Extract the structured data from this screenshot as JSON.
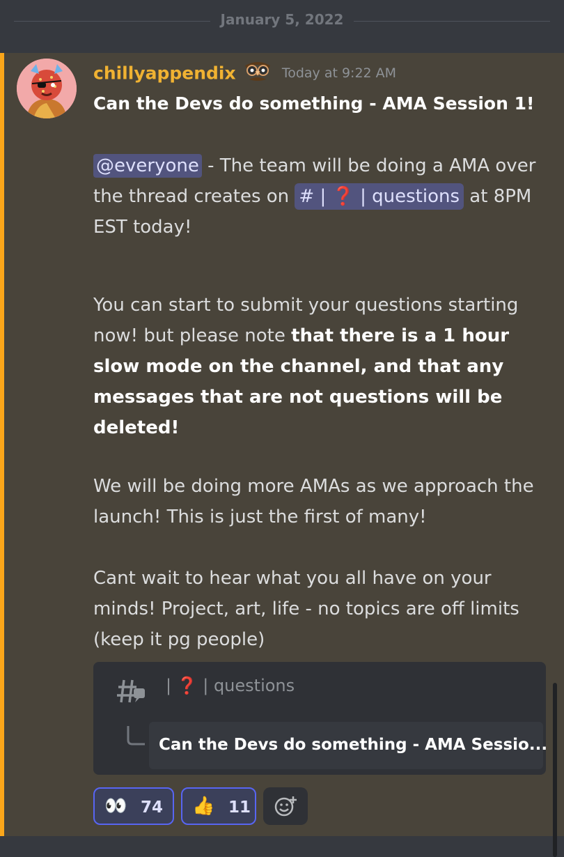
{
  "date_divider": {
    "text": "January 5, 2022"
  },
  "message": {
    "username": "chillyappendix",
    "badge_icon": "disguise-glasses-icon",
    "timestamp": "Today at 9:22 AM",
    "title": "Can the Devs do something - AMA Session 1!",
    "mention": "@everyone",
    "intro_text": " - The team will be doing a AMA over the thread creates on ",
    "channel_mention": "# | ❓ | questions",
    "intro_tail": " at 8PM EST today!",
    "para2_start": "You can start to submit your questions starting now! but please note ",
    "para2_bold": "that there is a 1 hour slow mode on the channel, and that any messages that are not questions will be deleted!",
    "para3": "We will be doing more AMAs as we approach the launch! This is just the first of many!",
    "para4": "Cant wait to hear what you all have on your minds! Project, art, life - no topics are off limits (keep it pg people)",
    "highlight_color": "#faa61a",
    "username_color": "#f0b232"
  },
  "thread_embed": {
    "channel_label": "| ❓ | questions",
    "thread_title": "Can the Devs do something - AMA Sessio..."
  },
  "reactions": [
    {
      "emoji": "👀",
      "icon": "eyes-emoji-icon",
      "count": "74"
    },
    {
      "emoji": "👍",
      "icon": "thumbs-up-emoji-icon",
      "count": "11"
    }
  ],
  "add_reaction_icon": "add-reaction-icon"
}
